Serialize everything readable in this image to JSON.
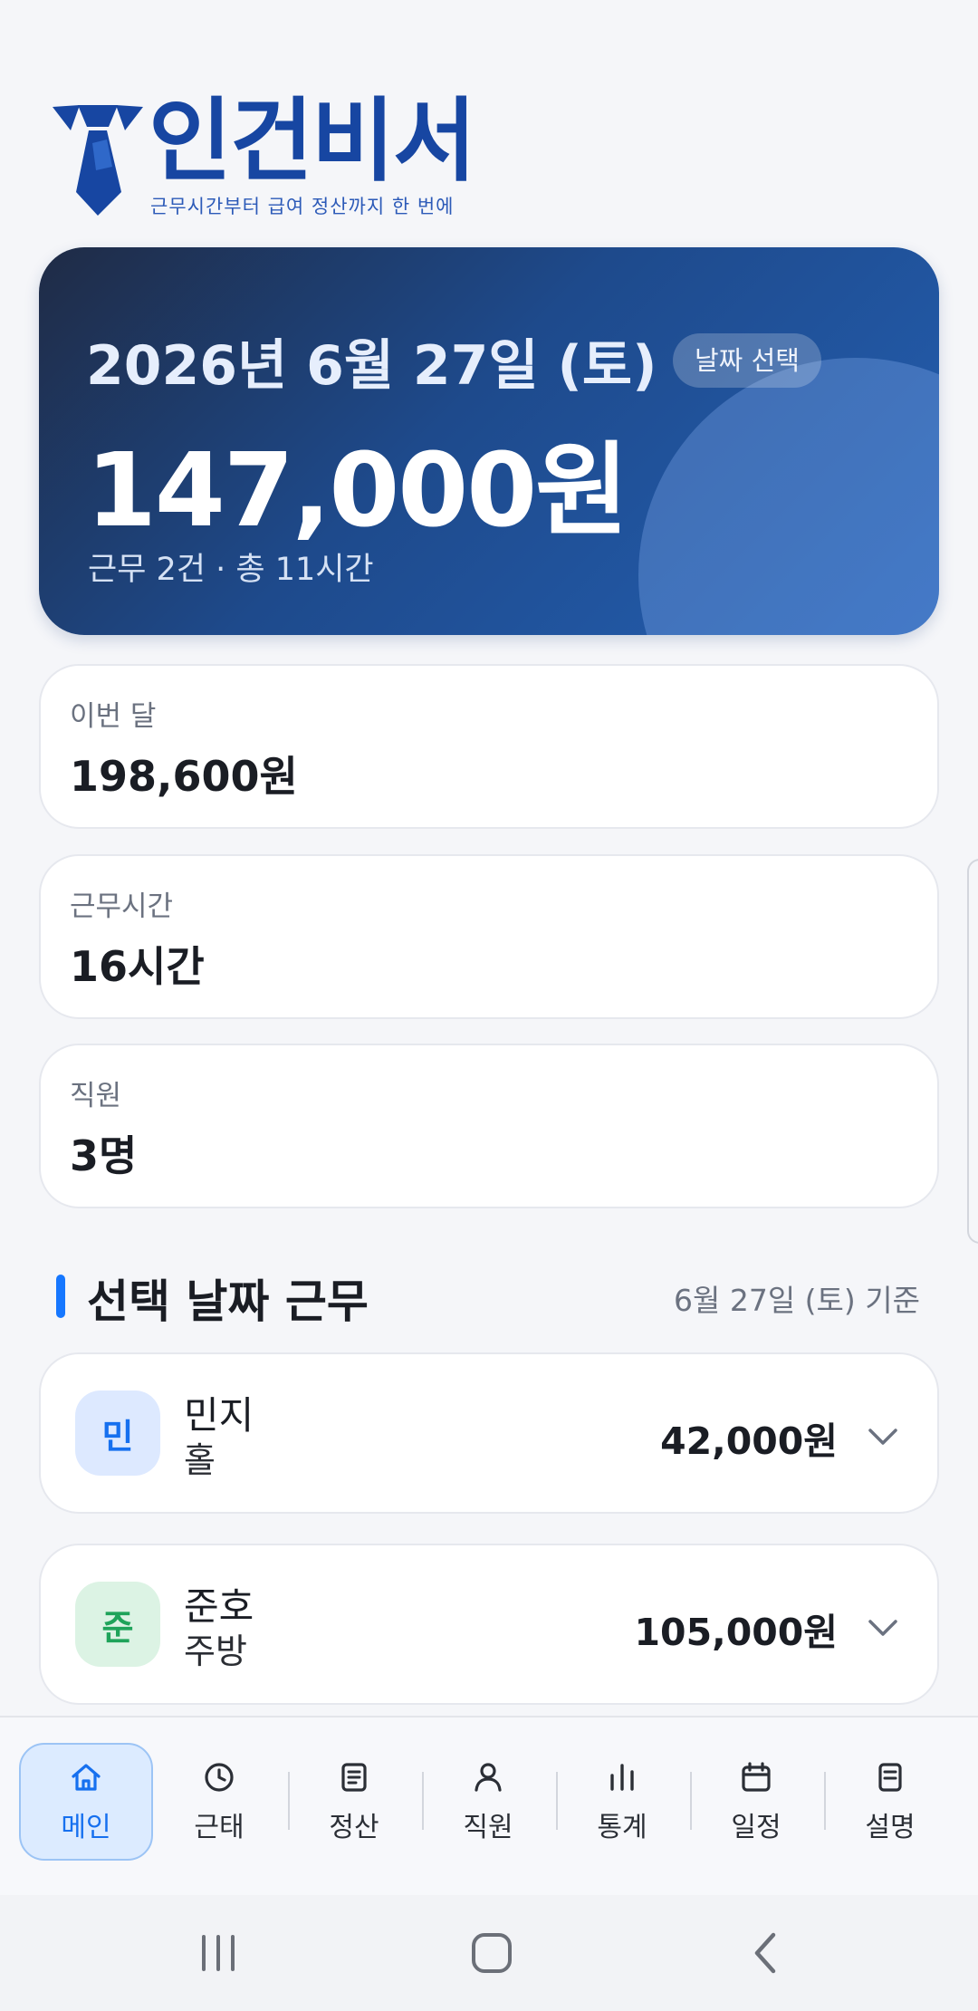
{
  "app": {
    "name": "인건비서",
    "tagline": "근무시간부터 급여 정산까지 한 번에"
  },
  "hero": {
    "date": "2026년 6월 27일 (토)",
    "date_button": "날짜 선택",
    "amount": "147,000원",
    "summary": "근무 2건 · 총 11시간"
  },
  "stats": [
    {
      "label": "이번 달",
      "value": "198,600원"
    },
    {
      "label": "근무시간",
      "value": "16시간"
    },
    {
      "label": "직원",
      "value": "3명"
    }
  ],
  "section": {
    "title": "선택 날짜 근무",
    "meta": "6월 27일 (토) 기준"
  },
  "works": [
    {
      "initial": "민",
      "name": "민지",
      "role": "홀",
      "amount": "42,000원",
      "avatar_bg": "#dde9ff",
      "avatar_fg": "#1670ef"
    },
    {
      "initial": "준",
      "name": "준호",
      "role": "주방",
      "amount": "105,000원",
      "avatar_bg": "#dcf3e4",
      "avatar_fg": "#1fa35a"
    }
  ],
  "nav": [
    {
      "label": "메인",
      "icon": "home-icon",
      "active": true
    },
    {
      "label": "근태",
      "icon": "clock-icon",
      "active": false
    },
    {
      "label": "정산",
      "icon": "document-icon",
      "active": false
    },
    {
      "label": "직원",
      "icon": "person-icon",
      "active": false
    },
    {
      "label": "통계",
      "icon": "bar-chart-icon",
      "active": false
    },
    {
      "label": "일정",
      "icon": "calendar-icon",
      "active": false
    },
    {
      "label": "설명",
      "icon": "note-icon",
      "active": false
    }
  ],
  "colors": {
    "brand": "#1746a2",
    "accent": "#1677ff"
  }
}
